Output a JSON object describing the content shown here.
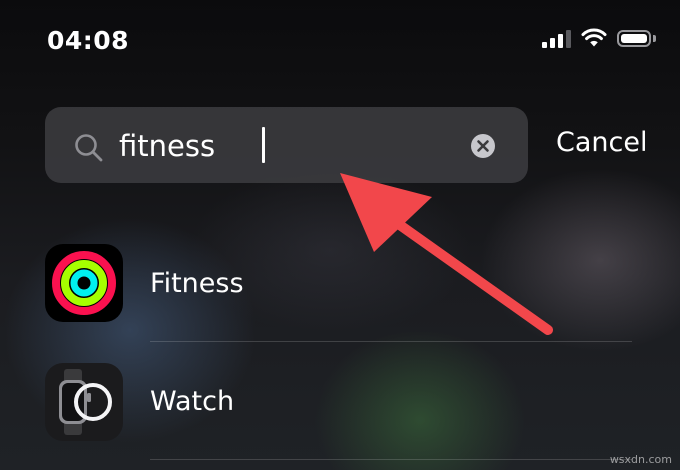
{
  "status_bar": {
    "time": "04:08",
    "icons": [
      "cellular-signal-icon",
      "wifi-icon",
      "battery-icon"
    ]
  },
  "search": {
    "value": "fitness",
    "placeholder": "",
    "search_icon": "search-icon",
    "clear_icon": "clear-icon",
    "cancel_label": "Cancel"
  },
  "results": [
    {
      "label": "Fitness",
      "icon": "fitness-app-icon"
    },
    {
      "label": "Watch",
      "icon": "watch-app-icon"
    }
  ],
  "annotation": {
    "arrow_color": "#f2474b",
    "points_to": "search-input"
  },
  "watermark": "wsxdn.com",
  "colors": {
    "search_bg": "#3e3e42",
    "accent_red": "#f2474b",
    "fitness_move": "#fa114f",
    "fitness_exercise": "#a6ff00",
    "fitness_stand": "#00f0f0"
  }
}
